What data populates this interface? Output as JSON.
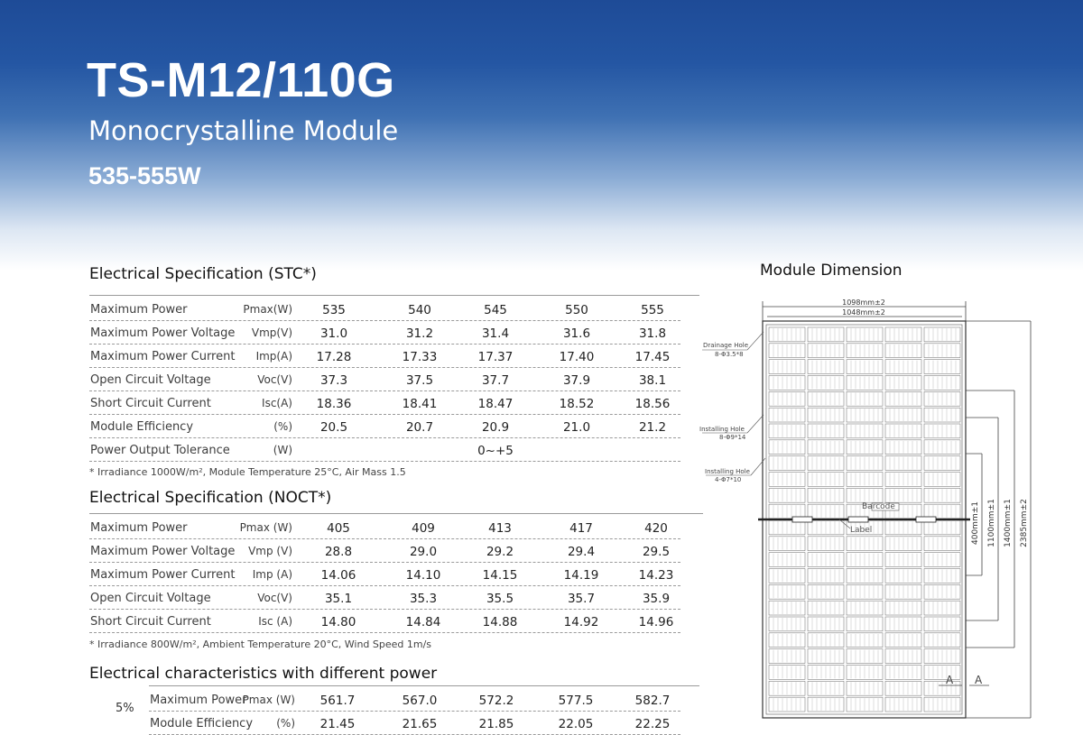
{
  "header": {
    "model": "TS-M12/110G",
    "type": "Monocrystalline Module",
    "power_range": "535-555W"
  },
  "stc": {
    "title": "Electrical Specification (STC*)",
    "rows": [
      {
        "label": "Maximum Power",
        "unit": "Pmax(W)",
        "values": [
          "535",
          "540",
          "545",
          "550",
          "555"
        ]
      },
      {
        "label": "Maximum Power Voltage",
        "unit": "Vmp(V)",
        "values": [
          "31.0",
          "31.2",
          "31.4",
          "31.6",
          "31.8"
        ]
      },
      {
        "label": "Maximum Power Current",
        "unit": "Imp(A)",
        "values": [
          "17.28",
          "17.33",
          "17.37",
          "17.40",
          "17.45"
        ]
      },
      {
        "label": "Open Circuit Voltage",
        "unit": "Voc(V)",
        "values": [
          "37.3",
          "37.5",
          "37.7",
          "37.9",
          "38.1"
        ]
      },
      {
        "label": "Short Circuit Current",
        "unit": "Isc(A)",
        "values": [
          "18.36",
          "18.41",
          "18.47",
          "18.52",
          "18.56"
        ]
      },
      {
        "label": "Module Efficiency",
        "unit": "(%)",
        "values": [
          "20.5",
          "20.7",
          "20.9",
          "21.0",
          "21.2"
        ]
      },
      {
        "label": "Power Output Tolerance",
        "unit": "(W)",
        "values": [
          "",
          "",
          "0~+5",
          "",
          ""
        ]
      }
    ],
    "footnote": "* Irradiance 1000W/m², Module Temperature 25°C, Air Mass 1.5"
  },
  "noct": {
    "title": "Electrical Specification (NOCT*)",
    "rows": [
      {
        "label": "Maximum Power",
        "unit": "Pmax (W)",
        "values": [
          "405",
          "409",
          "413",
          "417",
          "420"
        ]
      },
      {
        "label": "Maximum Power Voltage",
        "unit": "Vmp (V)",
        "values": [
          "28.8",
          "29.0",
          "29.2",
          "29.4",
          "29.5"
        ]
      },
      {
        "label": "Maximum Power Current",
        "unit": "Imp (A)",
        "values": [
          "14.06",
          "14.10",
          "14.15",
          "14.19",
          "14.23"
        ]
      },
      {
        "label": "Open Circuit Voltage",
        "unit": "Voc(V)",
        "values": [
          "35.1",
          "35.3",
          "35.5",
          "35.7",
          "35.9"
        ]
      },
      {
        "label": "Short Circuit Current",
        "unit": "Isc (A)",
        "values": [
          "14.80",
          "14.84",
          "14.88",
          "14.92",
          "14.96"
        ]
      }
    ],
    "footnote": "* Irradiance 800W/m², Ambient Temperature 20°C, Wind Speed 1m/s"
  },
  "different_power": {
    "title": "Electrical characteristics with different power",
    "group_label": "5%",
    "rows": [
      {
        "label": "Maximum Power",
        "unit": "Pmax (W)",
        "values": [
          "561.7",
          "567.0",
          "572.2",
          "577.5",
          "582.7"
        ]
      },
      {
        "label": "Module Efficiency",
        "unit": "(%)",
        "values": [
          "21.45",
          "21.65",
          "21.85",
          "22.05",
          "22.25"
        ]
      }
    ]
  },
  "dimension": {
    "title": "Module Dimension",
    "width_outer": "1098mm±2",
    "width_inner": "1048mm±2",
    "dim_400": "400mm±1",
    "dim_1100": "1100mm±1",
    "dim_1400": "1400mm±1",
    "dim_2385": "2385mm±2",
    "drainage_hole": "Drainage Hole",
    "drainage_hole_spec": "8-Φ3.5*8",
    "installing_hole_1": "Installing Hole",
    "installing_hole_1_spec": "8-Φ9*14",
    "installing_hole_2": "Installing Hole",
    "installing_hole_2_spec": "4-Φ7*10",
    "barcode": "Barcode",
    "label": "Label",
    "section_mark": "A"
  }
}
